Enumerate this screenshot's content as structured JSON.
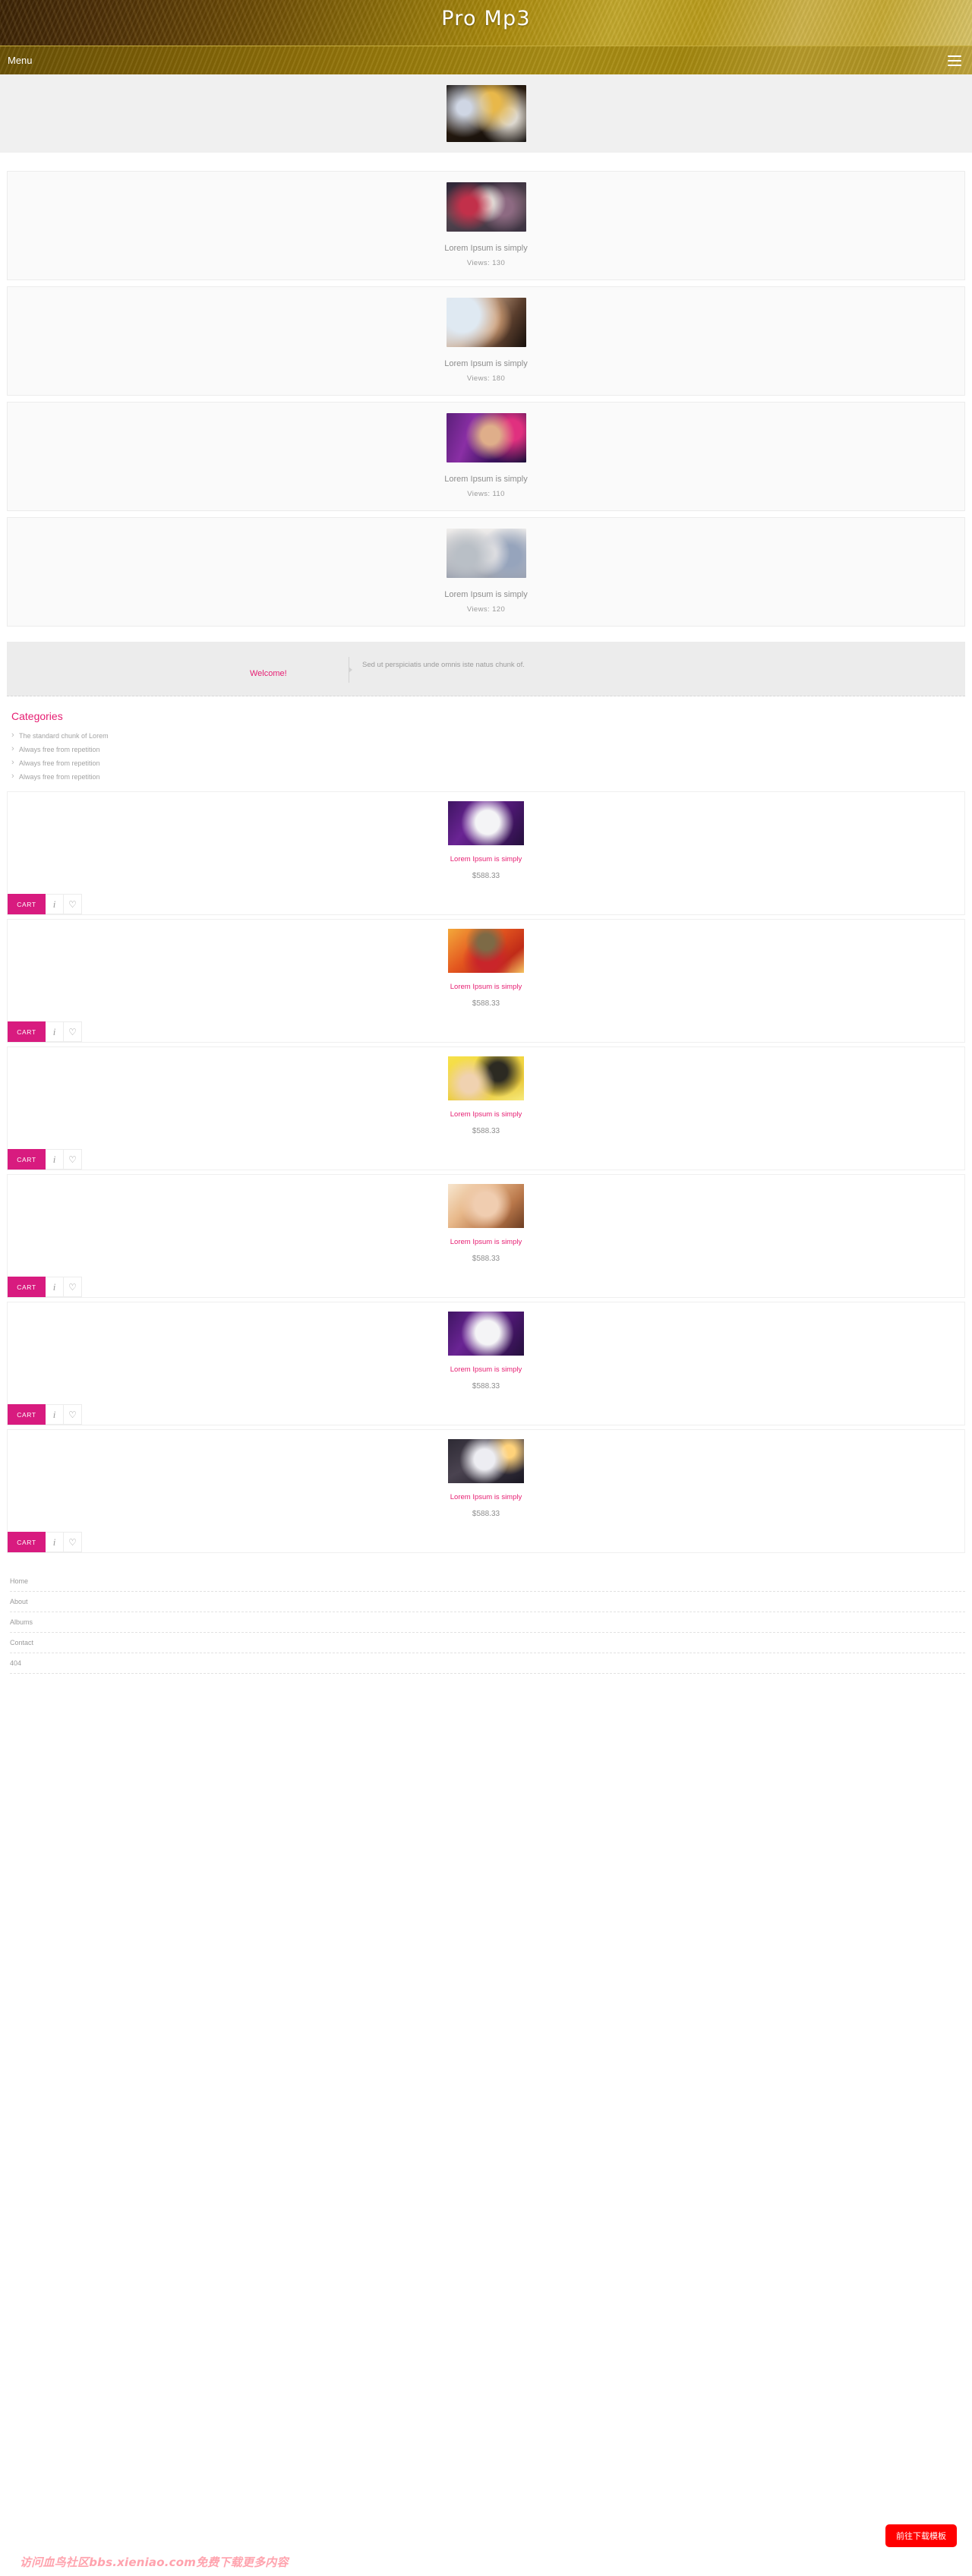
{
  "header": {
    "brand_title": "Pro Mp3",
    "nav_label": "Menu",
    "menu_icon": "hamburger-icon",
    "gradient_from": "#3a2206",
    "gradient_to": "#d6c268"
  },
  "hero": {
    "image_alt": "band-on-stage"
  },
  "news": {
    "items": [
      {
        "title": "Lorem Ipsum is simply",
        "views_label": "Views:",
        "views": "130",
        "image": "crowd-performers"
      },
      {
        "title": "Lorem Ipsum is simply",
        "views_label": "Views:",
        "views": "180",
        "image": "singer-with-microphone"
      },
      {
        "title": "Lorem Ipsum is simply",
        "views_label": "Views:",
        "views": "110",
        "image": "singer-on-purple-stage"
      },
      {
        "title": "Lorem Ipsum is simply",
        "views_label": "Views:",
        "views": "120",
        "image": "boy-band-group"
      }
    ]
  },
  "welcome": {
    "title": "Welcome!",
    "text": "Sed ut perspiciatis unde omnis iste natus chunk of."
  },
  "categories": {
    "heading": "Categories",
    "items": [
      "The standard chunk of Lorem",
      "Always free from repetition",
      "Always free from repetition",
      "Always free from repetition"
    ]
  },
  "products": {
    "cart_label": "CART",
    "info_icon": "info-icon",
    "wishlist_icon": "heart-icon",
    "items": [
      {
        "name": "Lorem Ipsum is simply",
        "price": "$588.33",
        "image": "singer-white-suit-purple"
      },
      {
        "name": "Lorem Ipsum is simply",
        "price": "$588.33",
        "image": "woman-with-hat-orange"
      },
      {
        "name": "Lorem Ipsum is simply",
        "price": "$588.33",
        "image": "pretty-yellow-album"
      },
      {
        "name": "Lorem Ipsum is simply",
        "price": "$588.33",
        "image": "female-portrait-closeup"
      },
      {
        "name": "Lorem Ipsum is simply",
        "price": "$588.33",
        "image": "performer-white-suit"
      },
      {
        "name": "Lorem Ipsum is simply",
        "price": "$588.33",
        "image": "performer-on-stage-dark"
      }
    ]
  },
  "footer": {
    "links": [
      "Home",
      "About",
      "Albums",
      "Contact",
      "404"
    ]
  },
  "overlay": {
    "watermark": "访问血鸟社区bbs.xieniao.com免费下载更多内容",
    "download_button": "前往下载模板",
    "download_color": "#ff0000",
    "accent_color": "#e61e72"
  }
}
